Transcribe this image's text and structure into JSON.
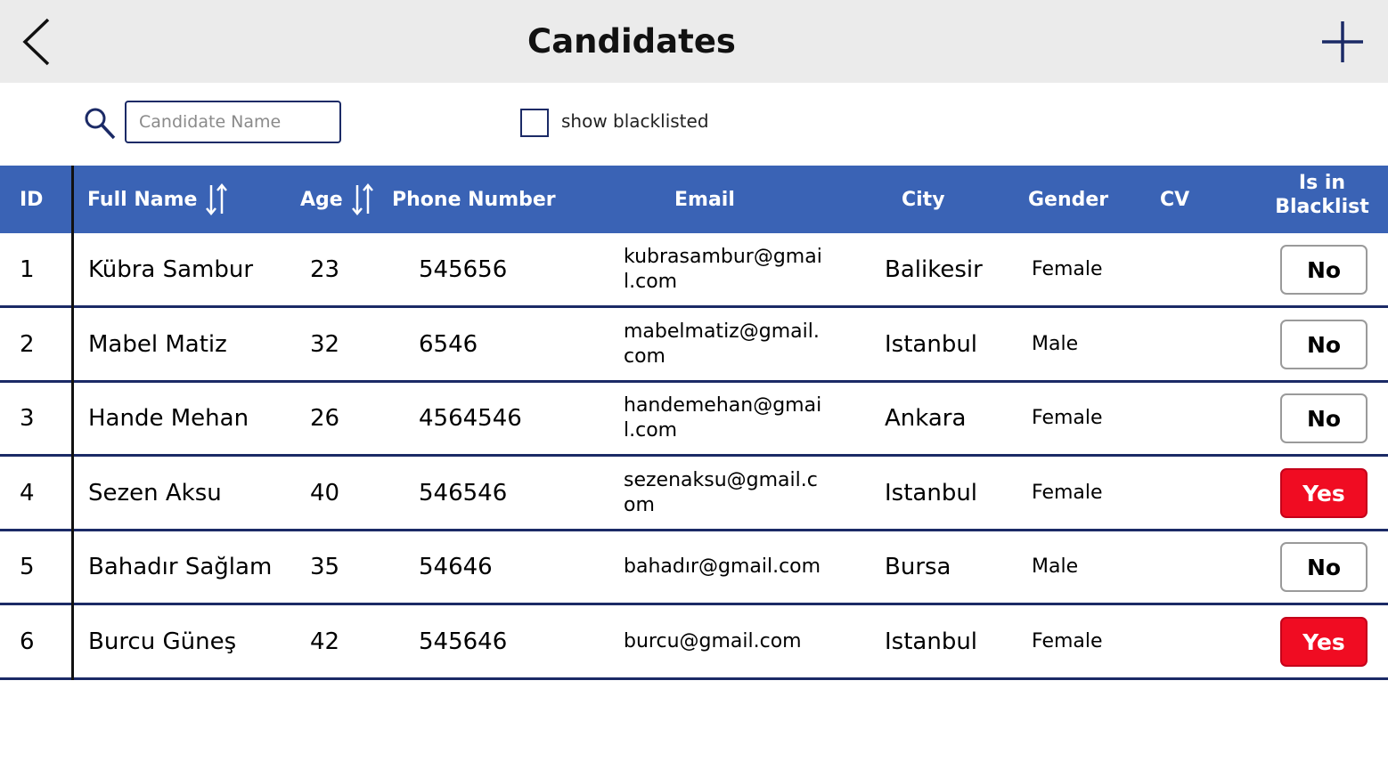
{
  "header": {
    "title": "Candidates",
    "back_icon": "chevron-left-icon",
    "add_icon": "plus-icon"
  },
  "filters": {
    "search_icon": "search-icon",
    "search_placeholder": "Candidate Name",
    "search_value": "",
    "show_blacklisted_label": "show blacklisted",
    "show_blacklisted_checked": false
  },
  "table": {
    "columns": {
      "id": "ID",
      "full_name": "Full Name",
      "age": "Age",
      "phone": "Phone Number",
      "email": "Email",
      "city": "City",
      "gender": "Gender",
      "cv": "CV",
      "blacklist_line1": "Is in",
      "blacklist_line2": "Blacklist"
    },
    "rows": [
      {
        "id": "1",
        "name": "Kübra  Sambur",
        "age": "23",
        "phone": "545656",
        "email": "kubrasambur@gmail.com",
        "city": "Balikesir",
        "gender": "Female",
        "blacklist": "No"
      },
      {
        "id": "2",
        "name": "Mabel Matiz",
        "age": "32",
        "phone": "6546",
        "email": "mabelmatiz@gmail.com",
        "city": "Istanbul",
        "gender": "Male",
        "blacklist": "No"
      },
      {
        "id": "3",
        "name": "Hande Mehan",
        "age": "26",
        "phone": "4564546",
        "email": "handemehan@gmail.com",
        "city": "Ankara",
        "gender": "Female",
        "blacklist": "No"
      },
      {
        "id": "4",
        "name": "Sezen Aksu",
        "age": "40",
        "phone": "546546",
        "email": "sezenaksu@gmail.com",
        "city": "Istanbul",
        "gender": "Female",
        "blacklist": "Yes"
      },
      {
        "id": "5",
        "name": "Bahadır Sağlam",
        "age": "35",
        "phone": "54646",
        "email": "bahadır@gmail.com",
        "city": "Bursa",
        "gender": "Male",
        "blacklist": "No"
      },
      {
        "id": "6",
        "name": "Burcu  Güneş",
        "age": "42",
        "phone": "545646",
        "email": "burcu@gmail.com",
        "city": "Istanbul",
        "gender": "Female",
        "blacklist": "Yes"
      }
    ]
  },
  "colors": {
    "header_bg": "#ebebeb",
    "table_header_bg": "#3a63b5",
    "row_border": "#1b2a66",
    "blacklist_yes": "#f00c22"
  }
}
